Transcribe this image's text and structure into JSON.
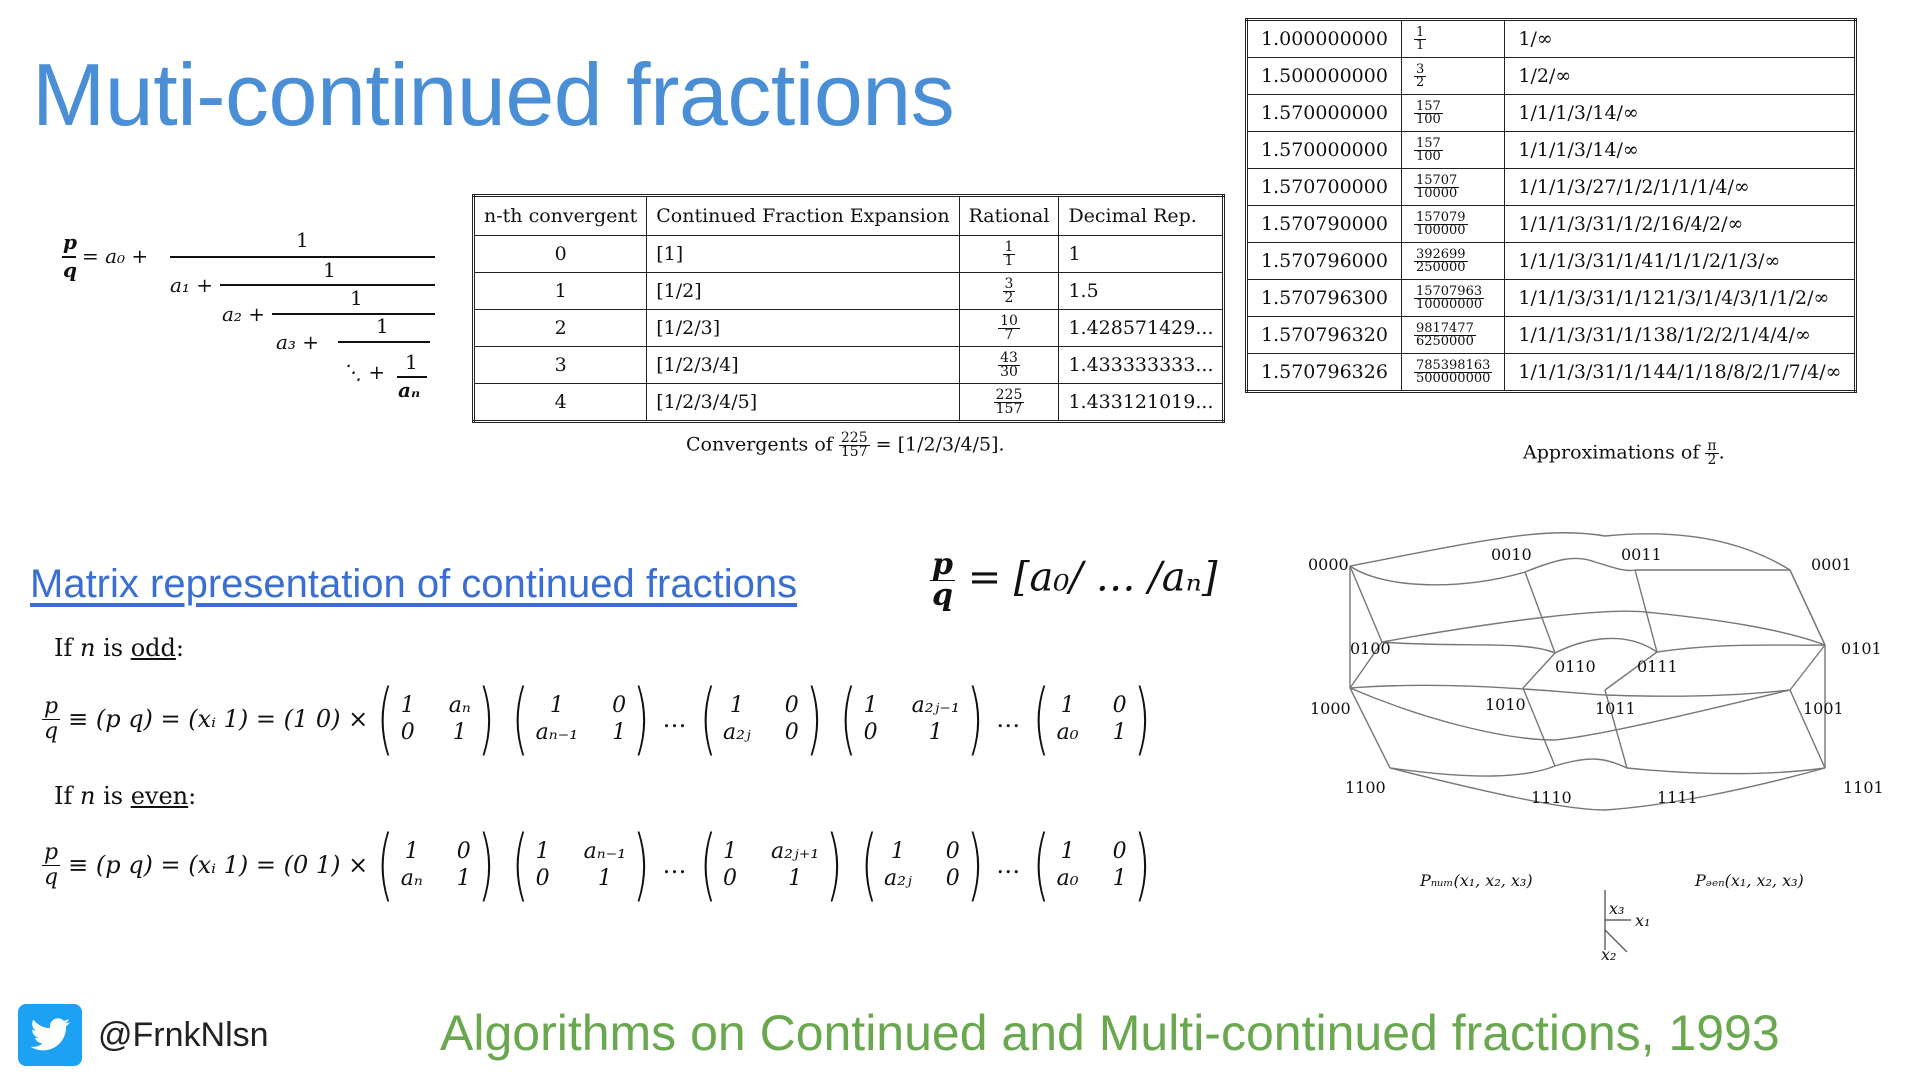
{
  "slide": {
    "title": "Muti-continued fractions",
    "subtitle": "Matrix representation of continued fractions",
    "footer": "Algorithms on Continued and Multi-continued fractions, 1993",
    "handle": "@FrnkNlsn",
    "colors": {
      "title": "#4a8fd6",
      "subtitle": "#3a6ed0",
      "footer": "#6aa84f",
      "twitter": "#1da1f2"
    }
  },
  "convergents_table": {
    "headers": [
      "n-th convergent",
      "Continued Fraction Expansion",
      "Rational",
      "Decimal Rep."
    ],
    "rows": [
      {
        "n": "0",
        "expansion": "[1]",
        "num": "1",
        "den": "1",
        "decimal": "1"
      },
      {
        "n": "1",
        "expansion": "[1/2]",
        "num": "3",
        "den": "2",
        "decimal": "1.5"
      },
      {
        "n": "2",
        "expansion": "[1/2/3]",
        "num": "10",
        "den": "7",
        "decimal": "1.428571429..."
      },
      {
        "n": "3",
        "expansion": "[1/2/3/4]",
        "num": "43",
        "den": "30",
        "decimal": "1.433333333..."
      },
      {
        "n": "4",
        "expansion": "[1/2/3/4/5]",
        "num": "225",
        "den": "157",
        "decimal": "1.433121019..."
      }
    ],
    "caption_prefix": "Convergents of",
    "caption_num": "225",
    "caption_den": "157",
    "caption_suffix": "= [1/2/3/4/5]."
  },
  "approx_table": {
    "rows": [
      {
        "decimal": "1.000000000",
        "num": "1",
        "den": "1",
        "expansion": "1/∞"
      },
      {
        "decimal": "1.500000000",
        "num": "3",
        "den": "2",
        "expansion": "1/2/∞"
      },
      {
        "decimal": "1.570000000",
        "num": "157",
        "den": "100",
        "expansion": "1/1/1/3/14/∞"
      },
      {
        "decimal": "1.570000000",
        "num": "157",
        "den": "100",
        "expansion": "1/1/1/3/14/∞"
      },
      {
        "decimal": "1.570700000",
        "num": "15707",
        "den": "10000",
        "expansion": "1/1/1/3/27/1/2/1/1/1/4/∞"
      },
      {
        "decimal": "1.570790000",
        "num": "157079",
        "den": "100000",
        "expansion": "1/1/1/3/31/1/2/16/4/2/∞"
      },
      {
        "decimal": "1.570796000",
        "num": "392699",
        "den": "250000",
        "expansion": "1/1/1/3/31/1/41/1/1/2/1/3/∞"
      },
      {
        "decimal": "1.570796300",
        "num": "15707963",
        "den": "10000000",
        "expansion": "1/1/1/3/31/1/121/3/1/4/3/1/1/2/∞"
      },
      {
        "decimal": "1.570796320",
        "num": "9817477",
        "den": "6250000",
        "expansion": "1/1/1/3/31/1/138/1/2/2/1/4/4/∞"
      },
      {
        "decimal": "1.570796326",
        "num": "785398163",
        "den": "500000000",
        "expansion": "1/1/1/3/31/1/144/1/18/8/2/1/7/4/∞"
      }
    ],
    "caption_prefix": "Approximations of",
    "caption_num": "π",
    "caption_den": "2",
    "caption_suffix": "."
  },
  "matrix": {
    "cond_odd_prefix": "If ",
    "cond_odd_var": "n",
    "cond_odd_mid": " is ",
    "cond_odd_word": "odd",
    "cond_odd_suffix": ":",
    "cond_even_prefix": "If ",
    "cond_even_var": "n",
    "cond_even_mid": " is ",
    "cond_even_word": "even",
    "cond_even_suffix": ":",
    "odd_lhs": "≡ (p q) = (xᵢ 1) = (1 0) ×",
    "even_lhs": "≡ (p q) = (xᵢ 1) = (0 1) ×",
    "odd_mats": [
      [
        "1",
        "aₙ",
        "0",
        "1"
      ],
      [
        "1",
        "0",
        "aₙ₋₁",
        "1"
      ],
      [
        "1",
        "0",
        "a₂ⱼ",
        "0"
      ],
      [
        "1",
        "a₂ⱼ₋₁",
        "0",
        "1"
      ],
      [
        "1",
        "0",
        "a₀",
        "1"
      ]
    ],
    "even_mats": [
      [
        "1",
        "0",
        "aₙ",
        "1"
      ],
      [
        "1",
        "aₙ₋₁",
        "0",
        "1"
      ],
      [
        "1",
        "a₂ⱼ₊₁",
        "0",
        "1"
      ],
      [
        "1",
        "0",
        "a₂ⱼ",
        "0"
      ],
      [
        "1",
        "0",
        "a₀",
        "1"
      ]
    ],
    "dots": "…",
    "pq_num": "p",
    "pq_den": "q",
    "big_rhs": "= [a₀/ … /aₙ]"
  },
  "cf_diagram": {
    "p": "p",
    "q": "q",
    "a0": "= a₀ +",
    "a1": "a₁ +",
    "a2": "a₂ +",
    "a3": "a₃ +",
    "dots": "⋱ +",
    "one": "1",
    "an": "aₙ"
  },
  "cube_diagram": {
    "labels": [
      "0000",
      "0010",
      "0011",
      "0001",
      "0100",
      "0110",
      "0111",
      "0101",
      "1000",
      "1010",
      "1011",
      "1001",
      "1100",
      "1110",
      "1111",
      "1101"
    ],
    "p_num": "Pₙᵤₘ(x₁, x₂, x₃)",
    "p_den": "Pₔₑₙ(x₁, x₂, x₃)",
    "axis_x3": "x₃",
    "axis_x1": "x₁",
    "axis_x2": "x₂"
  }
}
